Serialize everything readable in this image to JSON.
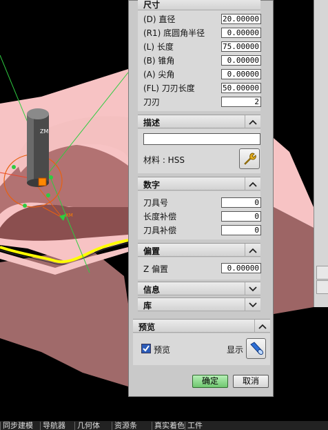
{
  "dialog": {
    "dimensions_title": "尺寸",
    "params": [
      {
        "label": "(D) 直径",
        "value": "20.00000"
      },
      {
        "label": "(R1) 底圆角半径",
        "value": "0.00000"
      },
      {
        "label": "(L) 长度",
        "value": "75.00000"
      },
      {
        "label": "(B) 锥角",
        "value": "0.00000"
      },
      {
        "label": "(A) 尖角",
        "value": "0.00000"
      },
      {
        "label": "(FL) 刀刃长度",
        "value": "50.00000"
      },
      {
        "label": "刀刃",
        "value": "2"
      }
    ],
    "description": {
      "title": "描述",
      "text_value": "",
      "material_label": "材料 : HSS"
    },
    "numbers": {
      "title": "数字",
      "rows": [
        {
          "label": "刀具号",
          "value": "0"
        },
        {
          "label": "长度补偿",
          "value": "0"
        },
        {
          "label": "刀具补偿",
          "value": "0"
        }
      ]
    },
    "offset": {
      "title": "偏置",
      "label": "Z 偏置",
      "value": "0.00000"
    },
    "info_title": "信息",
    "library_title": "库",
    "preview": {
      "title": "预览",
      "checkbox_label": "预览",
      "checked": true,
      "show_label": "显示"
    },
    "ok_label": "确定",
    "cancel_label": "取消"
  },
  "viewport": {
    "axis_label_z": "ZM",
    "axis_label_x": "XM"
  },
  "taskbar": {
    "items": [
      "同步建模",
      "导航器",
      "几何体",
      "资源条",
      "真实着色",
      "工件"
    ]
  },
  "colors": {
    "background": "#000000",
    "part_top": "#f7c3c4",
    "part_side": "#a26868",
    "highlight_edge": "#ffff00",
    "ok_button": "#7fd37f"
  }
}
